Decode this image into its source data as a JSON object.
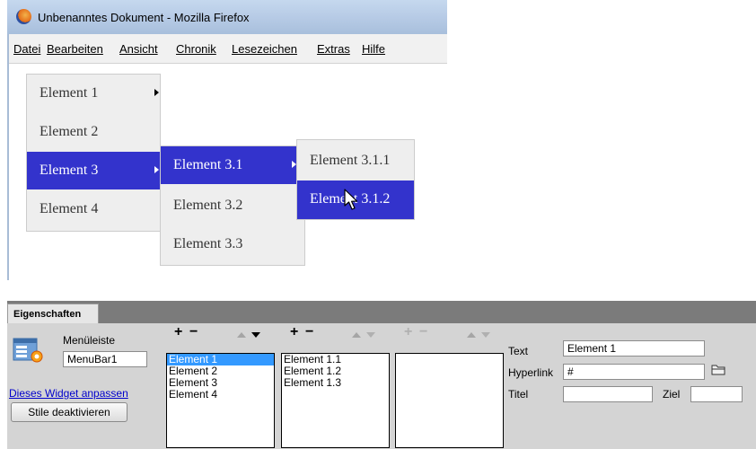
{
  "window": {
    "title": "Unbenanntes Dokument - Mozilla Firefox"
  },
  "menubar": {
    "items": [
      "Datei",
      "Bearbeiten",
      "Ansicht",
      "Chronik",
      "Lesezeichen",
      "Extras",
      "Hilfe"
    ]
  },
  "menu": {
    "level1": [
      {
        "label": "Element 1",
        "has_submenu": true,
        "active": false
      },
      {
        "label": "Element 2",
        "has_submenu": false,
        "active": false
      },
      {
        "label": "Element 3",
        "has_submenu": true,
        "active": true
      },
      {
        "label": "Element 4",
        "has_submenu": false,
        "active": false
      }
    ],
    "level2": [
      {
        "label": "Element 3.1",
        "has_submenu": true,
        "active": true
      },
      {
        "label": "Element 3.2",
        "has_submenu": false,
        "active": false
      },
      {
        "label": "Element 3.3",
        "has_submenu": false,
        "active": false
      }
    ],
    "level3": [
      {
        "label": "Element 3.1.1",
        "active": false
      },
      {
        "label": "Element 3.1.2",
        "active": true
      }
    ],
    "active_color": "#3333cc"
  },
  "properties": {
    "tab_label": "Eigenschaften",
    "widget_type_label": "Menüleiste",
    "widget_name": "MenuBar1",
    "customize_link": "Dieses Widget anpassen",
    "disable_styles_button": "Stile deaktivieren",
    "list1": {
      "items": [
        "Element 1",
        "Element 2",
        "Element 3",
        "Element 4"
      ],
      "selected": "Element 1"
    },
    "list2": {
      "items": [
        "Element 1.1",
        "Element 1.2",
        "Element 1.3"
      ]
    },
    "list3": {
      "items": []
    },
    "text_label": "Text",
    "text_value": "Element 1",
    "hyperlink_label": "Hyperlink",
    "hyperlink_value": "#",
    "title_label": "Titel",
    "title_value": "",
    "target_label": "Ziel",
    "target_value": "",
    "add_symbol": "+",
    "remove_symbol": "−",
    "selection_color": "#3399ff"
  }
}
